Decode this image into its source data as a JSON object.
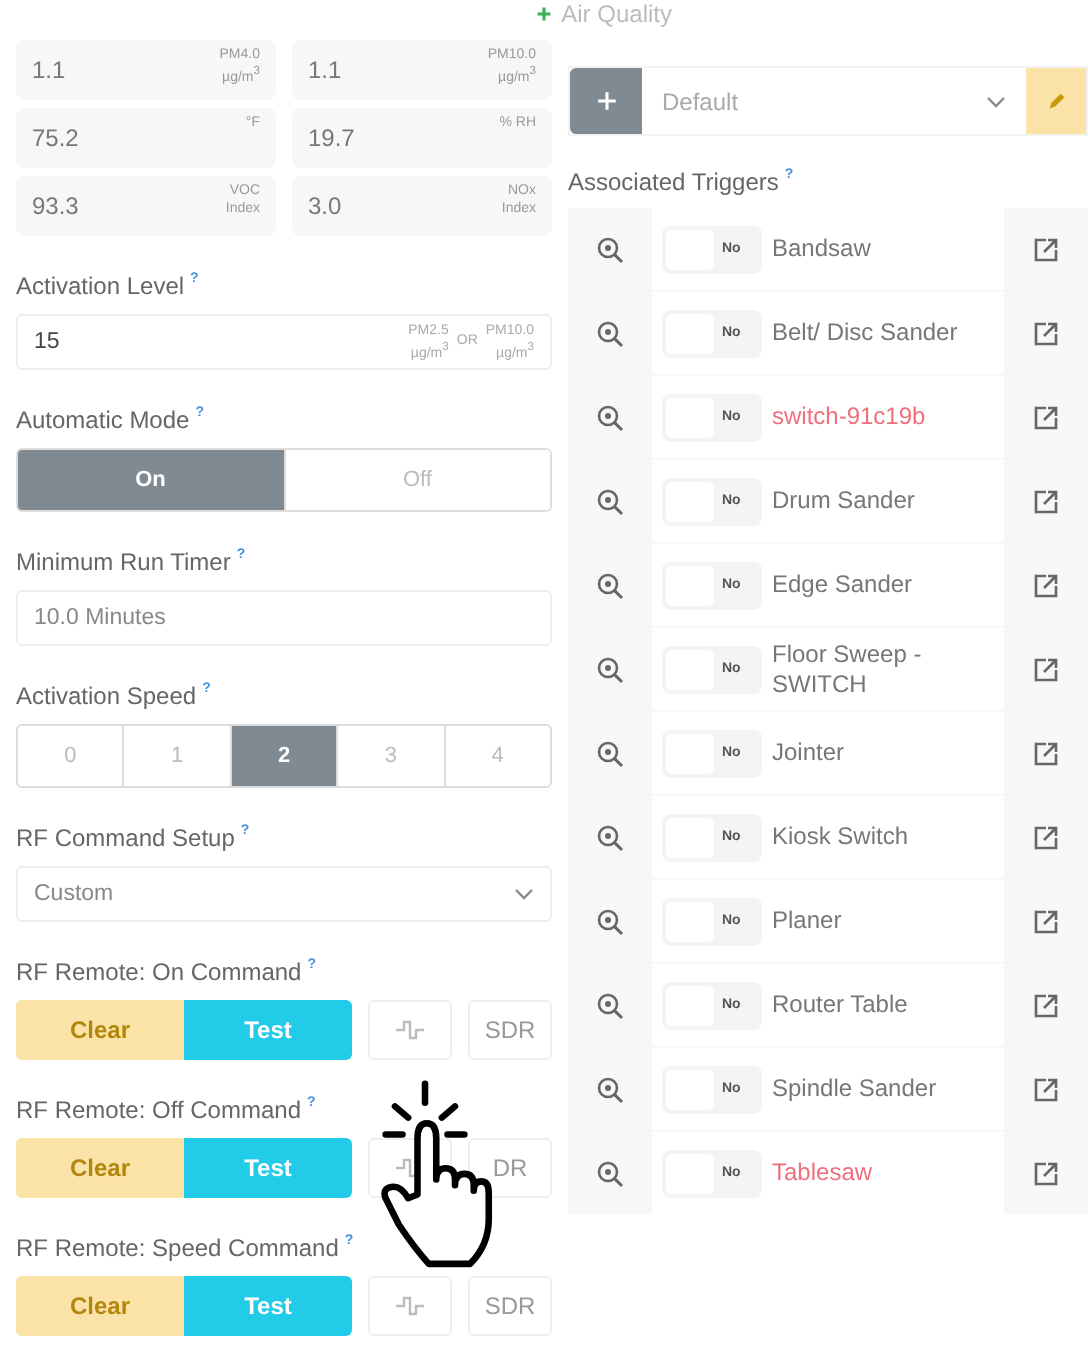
{
  "header": {
    "title": "Air Quality"
  },
  "readings": [
    {
      "value": "1.1",
      "unit": "PM4.0",
      "subunit": "µg/m$^{3}$"
    },
    {
      "value": "1.1",
      "unit": "PM10.0",
      "subunit": "µg/m$^{3}$"
    },
    {
      "value": "75.2",
      "unit": "°F"
    },
    {
      "value": "19.7",
      "unit": "% RH"
    },
    {
      "value": "93.3",
      "unit": "VOC",
      "subunit": "Index"
    },
    {
      "value": "3.0",
      "unit": "NOx",
      "subunit": "Index"
    }
  ],
  "activation_level": {
    "label": "Activation Level",
    "help": "?",
    "value": "15",
    "unit_a": "PM2.5",
    "sub_a": "µg/m$^{3}$",
    "or": "OR",
    "unit_b": "PM10.0",
    "sub_b": "µg/m$^{3}$"
  },
  "automatic_mode": {
    "label": "Automatic Mode",
    "help": "?",
    "options": [
      {
        "label": "On",
        "selected": true
      },
      {
        "label": "Off",
        "selected": false
      }
    ]
  },
  "minimum_run_timer": {
    "label": "Minimum Run Timer",
    "help": "?",
    "value": "10.0 Minutes"
  },
  "activation_speed": {
    "label": "Activation Speed",
    "help": "?",
    "options": [
      {
        "label": "0",
        "selected": false
      },
      {
        "label": "1",
        "selected": false
      },
      {
        "label": "2",
        "selected": true
      },
      {
        "label": "3",
        "selected": false
      },
      {
        "label": "4",
        "selected": false
      }
    ]
  },
  "rf_command_setup": {
    "label": "RF Command Setup",
    "help": "?",
    "value": "Custom"
  },
  "rf_commands": [
    {
      "label": "RF Remote: On Command",
      "help": "?",
      "clear": "Clear",
      "test": "Test",
      "sdr": "SDR"
    },
    {
      "label": "RF Remote: Off Command",
      "help": "?",
      "clear": "Clear",
      "test": "Test",
      "sdr": "DR"
    },
    {
      "label": "RF Remote: Speed Command",
      "help": "?",
      "clear": "Clear",
      "test": "Test",
      "sdr": "SDR"
    }
  ],
  "profile": {
    "value": "Default"
  },
  "associated_triggers": {
    "label": "Associated Triggers",
    "help": "?",
    "items": [
      {
        "toggle": "No",
        "on": false,
        "name": "Bandsaw",
        "flagged": false
      },
      {
        "toggle": "No",
        "on": false,
        "name": "Belt/ Disc Sander",
        "flagged": false
      },
      {
        "toggle": "No",
        "on": false,
        "name": "switch-91c19b",
        "flagged": true
      },
      {
        "toggle": "No",
        "on": false,
        "name": "Drum Sander",
        "flagged": false
      },
      {
        "toggle": "No",
        "on": false,
        "name": "Edge Sander",
        "flagged": false
      },
      {
        "toggle": "No",
        "on": false,
        "name": "Floor Sweep - SWITCH",
        "flagged": false
      },
      {
        "toggle": "No",
        "on": false,
        "name": "Jointer",
        "flagged": false
      },
      {
        "toggle": "No",
        "on": false,
        "name": "Kiosk Switch",
        "flagged": false
      },
      {
        "toggle": "No",
        "on": false,
        "name": "Planer",
        "flagged": false
      },
      {
        "toggle": "No",
        "on": false,
        "name": "Router Table",
        "flagged": false
      },
      {
        "toggle": "No",
        "on": false,
        "name": "Spindle Sander",
        "flagged": false
      },
      {
        "toggle": "No",
        "on": false,
        "name": "Tablesaw",
        "flagged": true
      }
    ]
  }
}
